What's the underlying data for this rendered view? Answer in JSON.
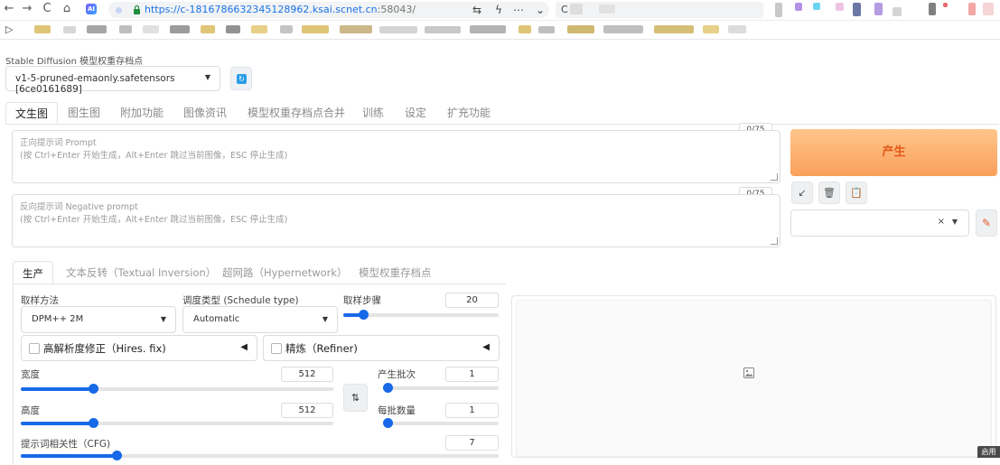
{
  "browser": {
    "url_main": "https://c-1816786632345128962.ksai.scnet.cn",
    "url_port": ":58043/",
    "search_text": "C",
    "ai_badge": "AI",
    "icons": [
      "back-icon",
      "forward-icon",
      "reload-icon",
      "home-icon",
      "ai-icon",
      "lock-icon",
      "translate-icon",
      "lightning-icon",
      "more-icon",
      "chevron-down-icon",
      "play-icon"
    ]
  },
  "checkpoint": {
    "label": "Stable Diffusion 模型权重存档点",
    "value": "v1-5-pruned-emaonly.safetensors [6ce0161689]"
  },
  "main_tabs": [
    "文生图",
    "图生图",
    "附加功能",
    "图像资讯",
    "模型权重存档点合并",
    "训练",
    "设定",
    "扩充功能"
  ],
  "prompt": {
    "title": "正向提示词 Prompt",
    "hint": "(按 Ctrl+Enter 开始生成，Alt+Enter 跳过当前图像，ESC 停止生成)",
    "counter": "0/75"
  },
  "negative_prompt": {
    "title": "反向提示词 Negative prompt",
    "hint": "(按 Ctrl+Enter 开始生成，Alt+Enter 跳过当前图像，ESC 停止生成)",
    "counter": "0/75"
  },
  "generate_label": "产生",
  "tool_buttons": [
    "↙",
    "🗑",
    "📋"
  ],
  "style_clear": "×",
  "edit_icon": "✎",
  "sub_tabs": [
    "生产",
    "文本反转（Textual Inversion）",
    "超网路（Hypernetwork）",
    "模型权重存档点"
  ],
  "sampler": {
    "label": "取样方法",
    "value": "DPM++ 2M"
  },
  "schedule": {
    "label": "调度类型 (Schedule type)",
    "value": "Automatic"
  },
  "steps": {
    "label": "取样步骤",
    "value": "20",
    "min": 1,
    "max": 150,
    "fraction": 0.13
  },
  "hires": {
    "label": "高解析度修正（Hires. fix)"
  },
  "refiner": {
    "label": "精炼（Refiner)"
  },
  "width": {
    "label": "宽度",
    "value": "512",
    "fraction": 0.23
  },
  "height": {
    "label": "高度",
    "value": "512",
    "fraction": 0.23
  },
  "batch_count": {
    "label": "产生批次",
    "value": "1",
    "fraction": 0.0
  },
  "batch_size": {
    "label": "每批数量",
    "value": "1",
    "fraction": 0.0
  },
  "cfg": {
    "label": "提示词相关性（CFG)",
    "value": "7",
    "fraction": 0.2
  },
  "swap_icon": "⇅",
  "corner_tip": "启用"
}
